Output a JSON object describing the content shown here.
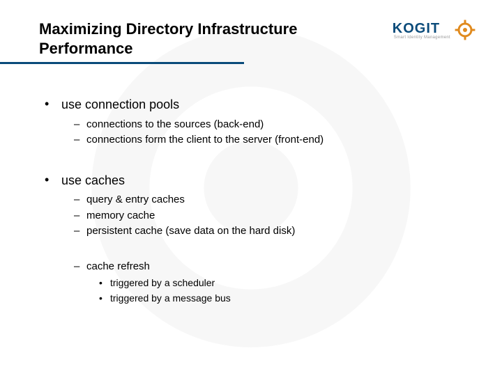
{
  "logo": {
    "text": "KOGIT",
    "tagline": "Smart Identity Management"
  },
  "title": "Maximizing Directory Infrastructure Performance",
  "bullets": [
    {
      "text": "use connection pools",
      "sub": [
        {
          "text": "connections to the sources (back-end)"
        },
        {
          "text": "connections form the client to the server (front-end)"
        }
      ]
    },
    {
      "text": "use caches",
      "sub": [
        {
          "text": "query & entry caches"
        },
        {
          "text": "memory cache"
        },
        {
          "text": "persistent cache (save data on the hard disk)"
        },
        {
          "text": "cache refresh",
          "gap": true,
          "sub": [
            {
              "text": "triggered by a scheduler"
            },
            {
              "text": "triggered by a message bus"
            }
          ]
        }
      ]
    }
  ]
}
